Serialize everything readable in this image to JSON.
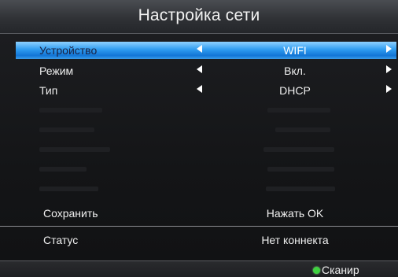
{
  "title": "Настройка сети",
  "rows": [
    {
      "label": "Устройство",
      "value": "WIFI",
      "selected": true
    },
    {
      "label": "Режим",
      "value": "Вкл.",
      "selected": false
    },
    {
      "label": "Тип",
      "value": "DHCP",
      "selected": false
    }
  ],
  "save": {
    "label": "Сохранить",
    "value": "Нажать OK"
  },
  "status": {
    "label": "Статус",
    "value": "Нет коннекта"
  },
  "footer": {
    "scan_label": "Сканир",
    "scan_color": "#3fd13f"
  },
  "colors": {
    "selection": "#1f8ae6",
    "background": "#111214"
  }
}
